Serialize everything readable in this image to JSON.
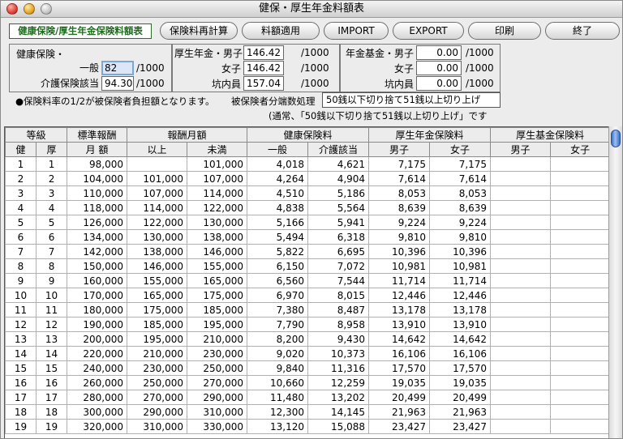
{
  "window": {
    "title": "健保・厚生年金料額表"
  },
  "toolbar": {
    "app_title": "健康保険/厚生年金保険料額表",
    "buttons": [
      "保険料再計算",
      "料額適用",
      "IMPORT",
      "EXPORT",
      "印刷",
      "終了"
    ]
  },
  "settings": {
    "health_label": "健康保険・",
    "general_label": "一般",
    "general_value": "82",
    "care_label": "介護保険該当",
    "care_value": "94.30",
    "unit": "/1000",
    "pension_label": "厚生年金・男子",
    "pension_male_value": "146.42",
    "female_label": "女子",
    "pension_female_value": "146.42",
    "miner_label": "坑内員",
    "pension_miner_value": "157.04",
    "fund_label": "年金基金・男子",
    "fund_male_value": "0.00",
    "fund_female_label": "女子",
    "fund_female_value": "0.00",
    "fund_miner_label": "坑内員",
    "fund_miner_value": "0.00",
    "note1": "●保険料率の1/2が被保険者負担額となります。",
    "rounding_label": "被保険者分端数処理",
    "rounding_value": "50銭以下切り捨て51銭以上切り上げ",
    "note2": "(通常、「50銭以下切り捨て51銭以上切り上げ」です"
  },
  "table": {
    "group_headers": {
      "grade": "等級",
      "standard": "標準報酬",
      "monthly": "報酬月額",
      "health": "健康保険料",
      "pension": "厚生年金保険料",
      "fund": "厚生基金保険料"
    },
    "sub_headers": {
      "ken": "健",
      "kou": "厚",
      "getsugaku": "月 額",
      "ijou": "以上",
      "miman": "未満",
      "ippan": "一般",
      "kaigo": "介護該当",
      "p_male": "男子",
      "p_female": "女子",
      "f_male": "男子",
      "f_female": "女子"
    },
    "rows": [
      [
        "1",
        "1",
        "98,000",
        "",
        "101,000",
        "4,018",
        "4,621",
        "7,175",
        "7,175",
        "",
        ""
      ],
      [
        "2",
        "2",
        "104,000",
        "101,000",
        "107,000",
        "4,264",
        "4,904",
        "7,614",
        "7,614",
        "",
        ""
      ],
      [
        "3",
        "3",
        "110,000",
        "107,000",
        "114,000",
        "4,510",
        "5,186",
        "8,053",
        "8,053",
        "",
        ""
      ],
      [
        "4",
        "4",
        "118,000",
        "114,000",
        "122,000",
        "4,838",
        "5,564",
        "8,639",
        "8,639",
        "",
        ""
      ],
      [
        "5",
        "5",
        "126,000",
        "122,000",
        "130,000",
        "5,166",
        "5,941",
        "9,224",
        "9,224",
        "",
        ""
      ],
      [
        "6",
        "6",
        "134,000",
        "130,000",
        "138,000",
        "5,494",
        "6,318",
        "9,810",
        "9,810",
        "",
        ""
      ],
      [
        "7",
        "7",
        "142,000",
        "138,000",
        "146,000",
        "5,822",
        "6,695",
        "10,396",
        "10,396",
        "",
        ""
      ],
      [
        "8",
        "8",
        "150,000",
        "146,000",
        "155,000",
        "6,150",
        "7,072",
        "10,981",
        "10,981",
        "",
        ""
      ],
      [
        "9",
        "9",
        "160,000",
        "155,000",
        "165,000",
        "6,560",
        "7,544",
        "11,714",
        "11,714",
        "",
        ""
      ],
      [
        "10",
        "10",
        "170,000",
        "165,000",
        "175,000",
        "6,970",
        "8,015",
        "12,446",
        "12,446",
        "",
        ""
      ],
      [
        "11",
        "11",
        "180,000",
        "175,000",
        "185,000",
        "7,380",
        "8,487",
        "13,178",
        "13,178",
        "",
        ""
      ],
      [
        "12",
        "12",
        "190,000",
        "185,000",
        "195,000",
        "7,790",
        "8,958",
        "13,910",
        "13,910",
        "",
        ""
      ],
      [
        "13",
        "13",
        "200,000",
        "195,000",
        "210,000",
        "8,200",
        "9,430",
        "14,642",
        "14,642",
        "",
        ""
      ],
      [
        "14",
        "14",
        "220,000",
        "210,000",
        "230,000",
        "9,020",
        "10,373",
        "16,106",
        "16,106",
        "",
        ""
      ],
      [
        "15",
        "15",
        "240,000",
        "230,000",
        "250,000",
        "9,840",
        "11,316",
        "17,570",
        "17,570",
        "",
        ""
      ],
      [
        "16",
        "16",
        "260,000",
        "250,000",
        "270,000",
        "10,660",
        "12,259",
        "19,035",
        "19,035",
        "",
        ""
      ],
      [
        "17",
        "17",
        "280,000",
        "270,000",
        "290,000",
        "11,480",
        "13,202",
        "20,499",
        "20,499",
        "",
        ""
      ],
      [
        "18",
        "18",
        "300,000",
        "290,000",
        "310,000",
        "12,300",
        "14,145",
        "21,963",
        "21,963",
        "",
        ""
      ],
      [
        "19",
        "19",
        "320,000",
        "310,000",
        "330,000",
        "13,120",
        "15,088",
        "23,427",
        "23,427",
        "",
        ""
      ]
    ]
  }
}
